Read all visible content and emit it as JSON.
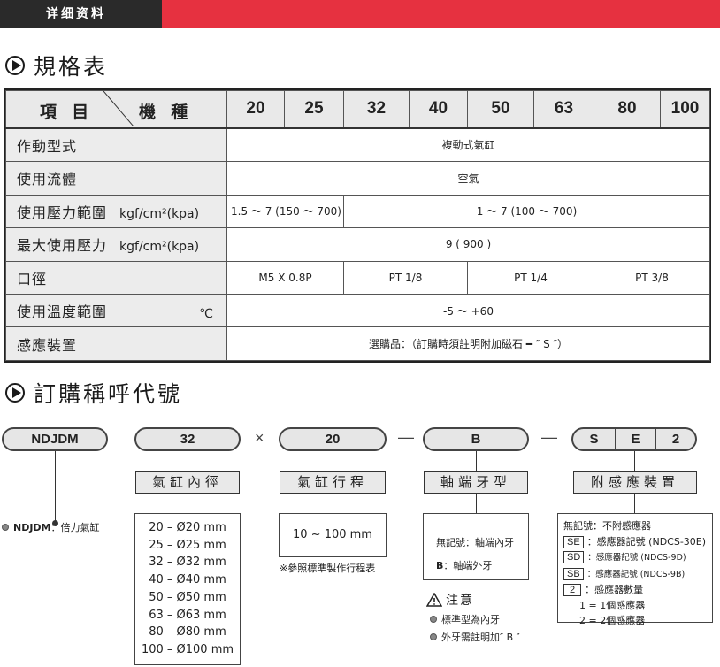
{
  "header": {
    "tag": "详细资料"
  },
  "section1": {
    "title": "規格表"
  },
  "spec_table": {
    "corner_left": "項 目",
    "corner_right": "機 種",
    "sizes": [
      "20",
      "25",
      "32",
      "40",
      "50",
      "63",
      "80",
      "100"
    ],
    "rows": {
      "action": {
        "label": "作動型式",
        "value": "複動式氣缸"
      },
      "medium": {
        "label": "使用流體",
        "value": "空氣"
      },
      "range": {
        "label": "使用壓力範圍",
        "unit": "kgf/cm²(kpa)",
        "value_small": "1.5 ～ 7 (150 ～ 700)",
        "value_rest": "1 ～ 7 (100 ～ 700)"
      },
      "max": {
        "label": "最大使用壓力",
        "unit": "kgf/cm²(kpa)",
        "value": "9 ( 900 )"
      },
      "port": {
        "label": "口徑",
        "values": [
          "M5 X 0.8P",
          "PT 1/8",
          "PT 1/4",
          "PT 3/8"
        ]
      },
      "temp": {
        "label": "使用溫度範圍",
        "unit": "℃",
        "value": "-5 ～ +60"
      },
      "sensor": {
        "label": "感應裝置",
        "value": "選購品：（訂購時須註明附加磁石 ━ ″ S ″）"
      }
    }
  },
  "section2": {
    "title": "訂購稱呼代號"
  },
  "order": {
    "model": "NDJDM",
    "bore": "32",
    "times": "×",
    "stroke": "20",
    "dash": "—",
    "end": "B",
    "s": "S",
    "e": "E",
    "num": "2",
    "model_note_code": "NDJDM",
    "model_note_text": "：倍力氣缸",
    "label_bore": "氣缸內徑",
    "label_stroke": "氣缸行程",
    "label_end": "軸端牙型",
    "label_sensor": "附感應裝置",
    "bores": [
      "20 – Ø20 mm",
      "25 – Ø25 mm",
      "32 – Ø32 mm",
      "40 – Ø40 mm",
      "50 – Ø50 mm",
      "63 – Ø63 mm",
      "80 – Ø80 mm",
      "100 – Ø100 mm"
    ],
    "stroke_range": "10 ~ 100 mm",
    "stroke_note": "※參照標準製作行程表",
    "end_none": "無記號：軸端內牙",
    "end_b_code": "B",
    "end_b_text": "：軸端外牙",
    "caution_title": "注意",
    "caution_1": "標準型為內牙",
    "caution_2": "外牙需註明加″ B ″",
    "sensor_none": "無記號：不附感應器",
    "sensor_codes": [
      {
        "code": "SE",
        "text": "：感應器記號 (NDCS-30E)"
      },
      {
        "code": "SD",
        "text": "：感應器記號 (NDCS-9D)"
      },
      {
        "code": "SB",
        "text": "：感應器記號 (NDCS-9B)"
      },
      {
        "code": "2",
        "text": "：感應器數量"
      }
    ],
    "sensor_q1": "1 = 1個感應器",
    "sensor_q2": "2 = 2個感應器"
  }
}
